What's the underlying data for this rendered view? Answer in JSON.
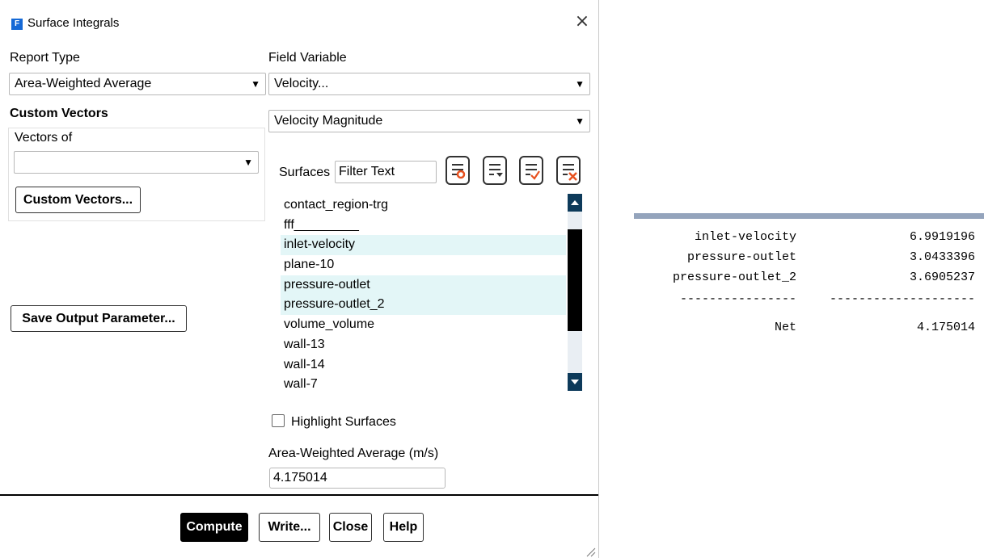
{
  "dialog": {
    "title": "Surface Integrals",
    "app_icon_letter": "F",
    "close_glyph": "×",
    "report_type": {
      "label": "Report Type",
      "value": "Area-Weighted Average"
    },
    "field_variable": {
      "label": "Field Variable",
      "category": "Velocity...",
      "quantity": "Velocity Magnitude"
    },
    "custom_vectors": {
      "heading": "Custom Vectors",
      "vectors_of_label": "Vectors of",
      "vectors_of_value": "",
      "button": "Custom Vectors..."
    },
    "save_output_button": "Save Output Parameter...",
    "surfaces": {
      "label": "Surfaces",
      "filter_placeholder": "Filter Text",
      "items": [
        {
          "name": "contact_region-trg",
          "selected": false
        },
        {
          "name": "fff_________",
          "selected": false
        },
        {
          "name": "inlet-velocity",
          "selected": true
        },
        {
          "name": "plane-10",
          "selected": false
        },
        {
          "name": "pressure-outlet",
          "selected": true
        },
        {
          "name": "pressure-outlet_2",
          "selected": true
        },
        {
          "name": "volume_volume",
          "selected": false
        },
        {
          "name": "wall-13",
          "selected": false
        },
        {
          "name": "wall-14",
          "selected": false
        },
        {
          "name": "wall-7",
          "selected": false
        }
      ]
    },
    "highlight_surfaces": {
      "label": "Highlight Surfaces",
      "checked": false
    },
    "result": {
      "label": "Area-Weighted Average (m/s)",
      "value": "4.175014"
    },
    "buttons": {
      "compute": "Compute",
      "write": "Write...",
      "close": "Close",
      "help": "Help"
    }
  },
  "console": {
    "rows": [
      {
        "name": "inlet-velocity",
        "value": "6.9919196"
      },
      {
        "name": "pressure-outlet",
        "value": "3.0433396"
      },
      {
        "name": "pressure-outlet_2",
        "value": "3.6905237"
      }
    ],
    "separator_left": "----------------",
    "separator_right": "--------------------",
    "net_label": "Net",
    "net_value": "4.175014"
  },
  "colors": {
    "selected_row": "#e3f6f7",
    "primary_button": "#000000",
    "app_icon": "#1569d6",
    "console_bar": "#94a4bc"
  }
}
